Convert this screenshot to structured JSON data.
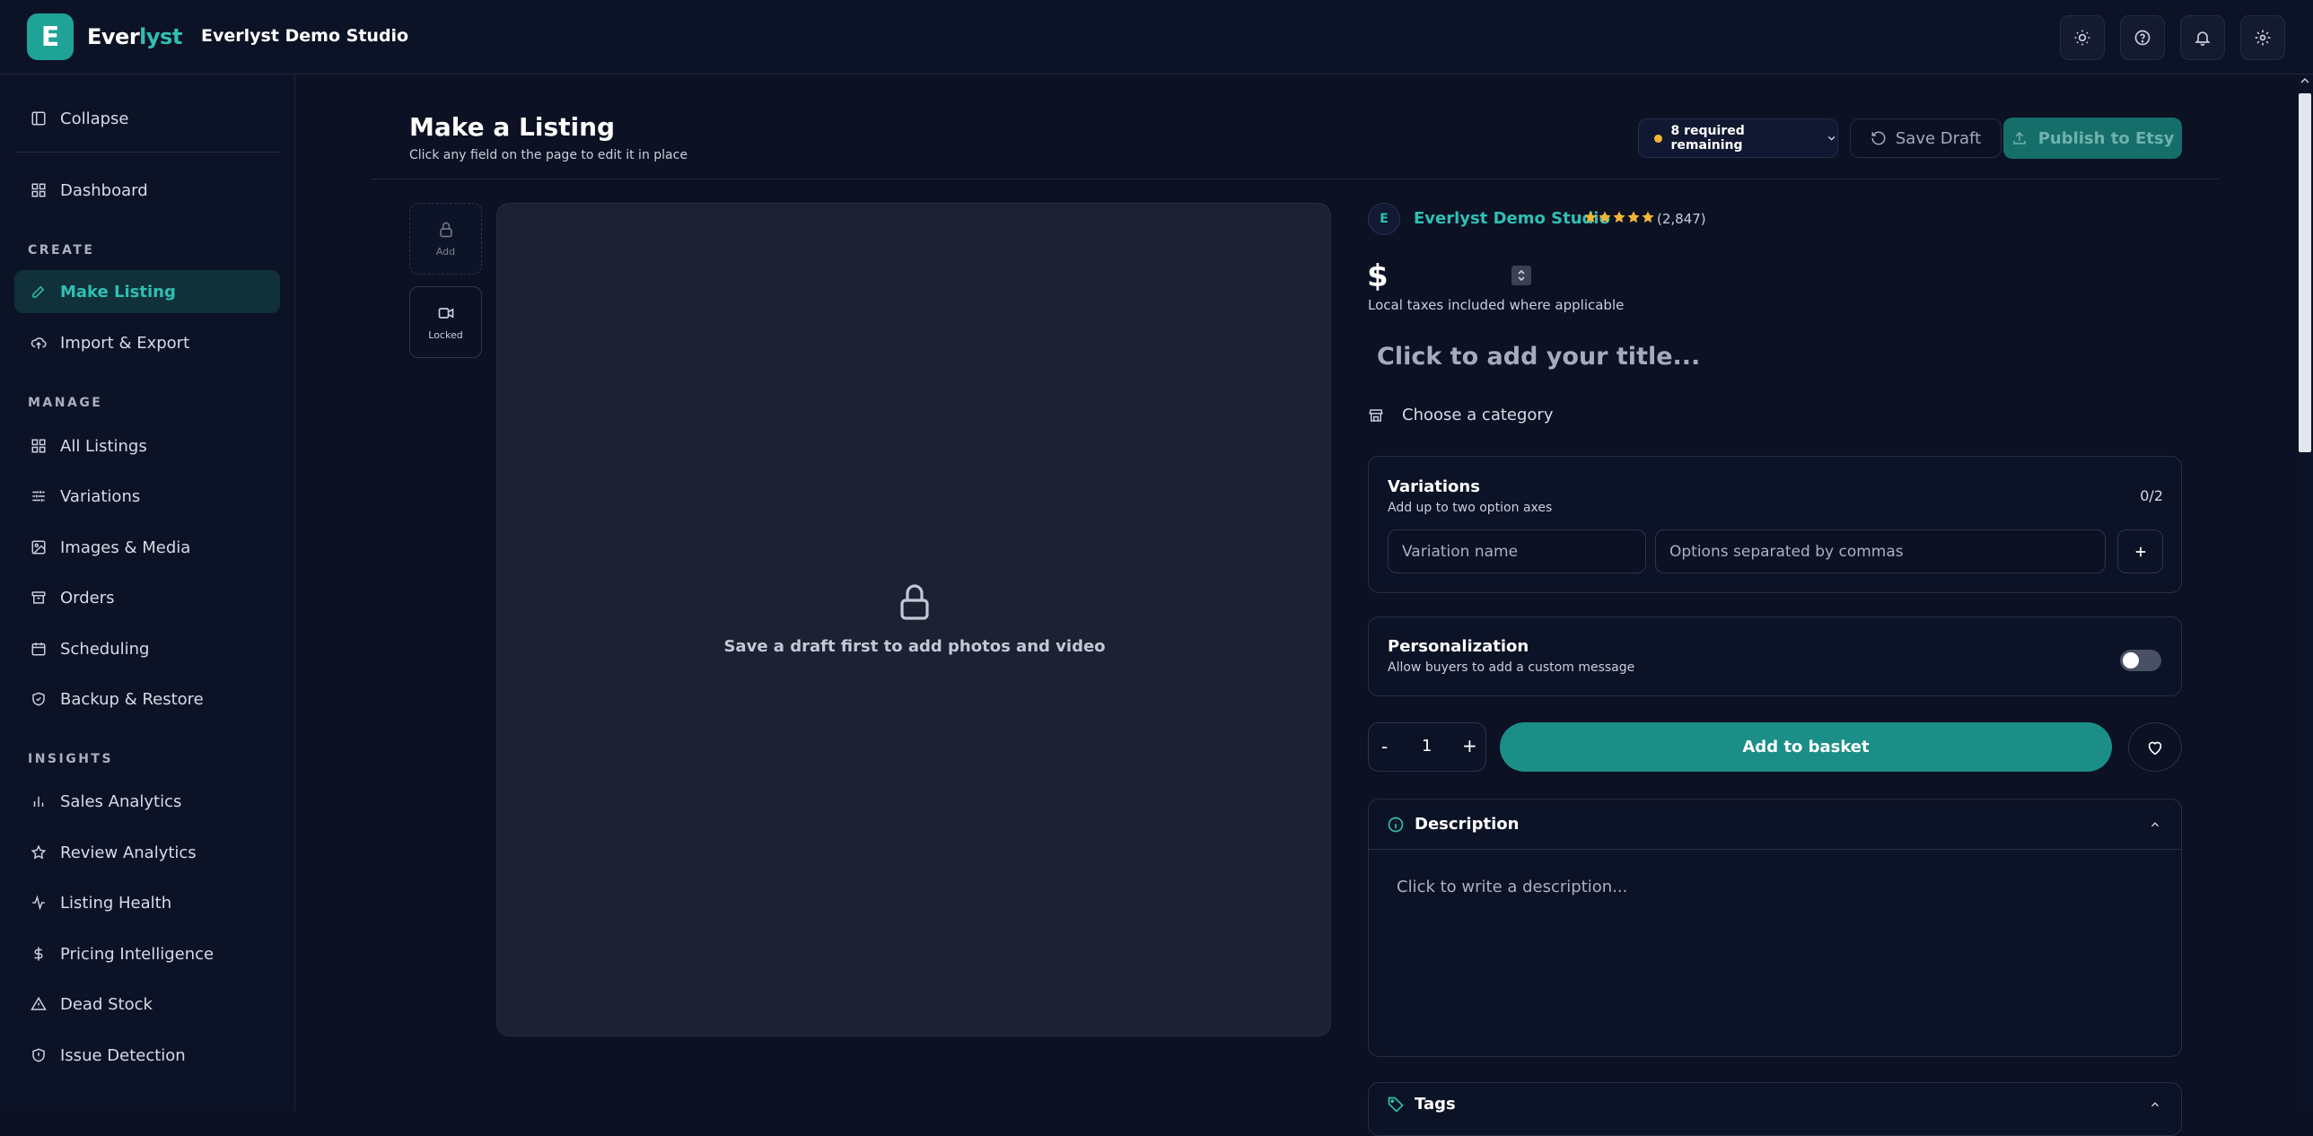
{
  "app": {
    "logo_letter": "E",
    "brand_part1": "Ever",
    "brand_part2": "lyst",
    "studio_name": "Everlyst Demo Studio",
    "accent_color": "#2fc0b2"
  },
  "top_icons": [
    "sun-icon",
    "help-icon",
    "bell-icon",
    "gear-icon"
  ],
  "sidebar": {
    "collapse_label": "Collapse",
    "dashboard_label": "Dashboard",
    "sections": {
      "create": "CREATE",
      "manage": "MANAGE",
      "insights": "INSIGHTS"
    },
    "create_items": [
      {
        "label": "Make Listing",
        "icon": "edit-icon",
        "active": true
      },
      {
        "label": "Import & Export",
        "icon": "cloud-upload-icon"
      }
    ],
    "manage_items": [
      {
        "label": "All Listings",
        "icon": "grid-icon"
      },
      {
        "label": "Variations",
        "icon": "sliders-icon"
      },
      {
        "label": "Images & Media",
        "icon": "image-icon"
      },
      {
        "label": "Orders",
        "icon": "box-icon"
      },
      {
        "label": "Scheduling",
        "icon": "calendar-icon"
      },
      {
        "label": "Backup & Restore",
        "icon": "shield-icon"
      }
    ],
    "insights_items": [
      {
        "label": "Sales Analytics",
        "icon": "bar-chart-icon"
      },
      {
        "label": "Review Analytics",
        "icon": "star-icon"
      },
      {
        "label": "Listing Health",
        "icon": "activity-icon"
      },
      {
        "label": "Pricing Intelligence",
        "icon": "dollar-icon"
      },
      {
        "label": "Dead Stock",
        "icon": "warning-icon"
      },
      {
        "label": "Issue Detection",
        "icon": "shield-alert-icon"
      }
    ]
  },
  "header": {
    "title": "Make a Listing",
    "subtitle": "Click any field on the page to edit it in place",
    "required_remaining": "8 required remaining",
    "status_color": "#f2b637",
    "save_draft": "Save Draft",
    "publish": "Publish to Etsy"
  },
  "media": {
    "add_label": "Add",
    "locked_label": "Locked",
    "message": "Save a draft first to add photos and video"
  },
  "listing": {
    "shop_avatar_letter": "E",
    "shop_name": "Everlyst Demo Studio",
    "rating_stars": 5,
    "review_count": "(2,847)",
    "currency_symbol": "$",
    "price_note": "Local taxes included where applicable",
    "title_placeholder": "Click to add your title...",
    "category_placeholder": "Choose a category",
    "variations": {
      "title": "Variations",
      "subtitle": "Add up to two option axes",
      "count": "0/2",
      "name_placeholder": "Variation name",
      "options_placeholder": "Options separated by commas"
    },
    "personalization": {
      "title": "Personalization",
      "subtitle": "Allow buyers to add a custom message",
      "enabled": false
    },
    "quantity": {
      "minus": "-",
      "value": "1",
      "plus": "+"
    },
    "add_to_basket": "Add to basket",
    "description": {
      "title": "Description",
      "placeholder": "Click to write a description..."
    },
    "tags": {
      "title": "Tags"
    }
  }
}
